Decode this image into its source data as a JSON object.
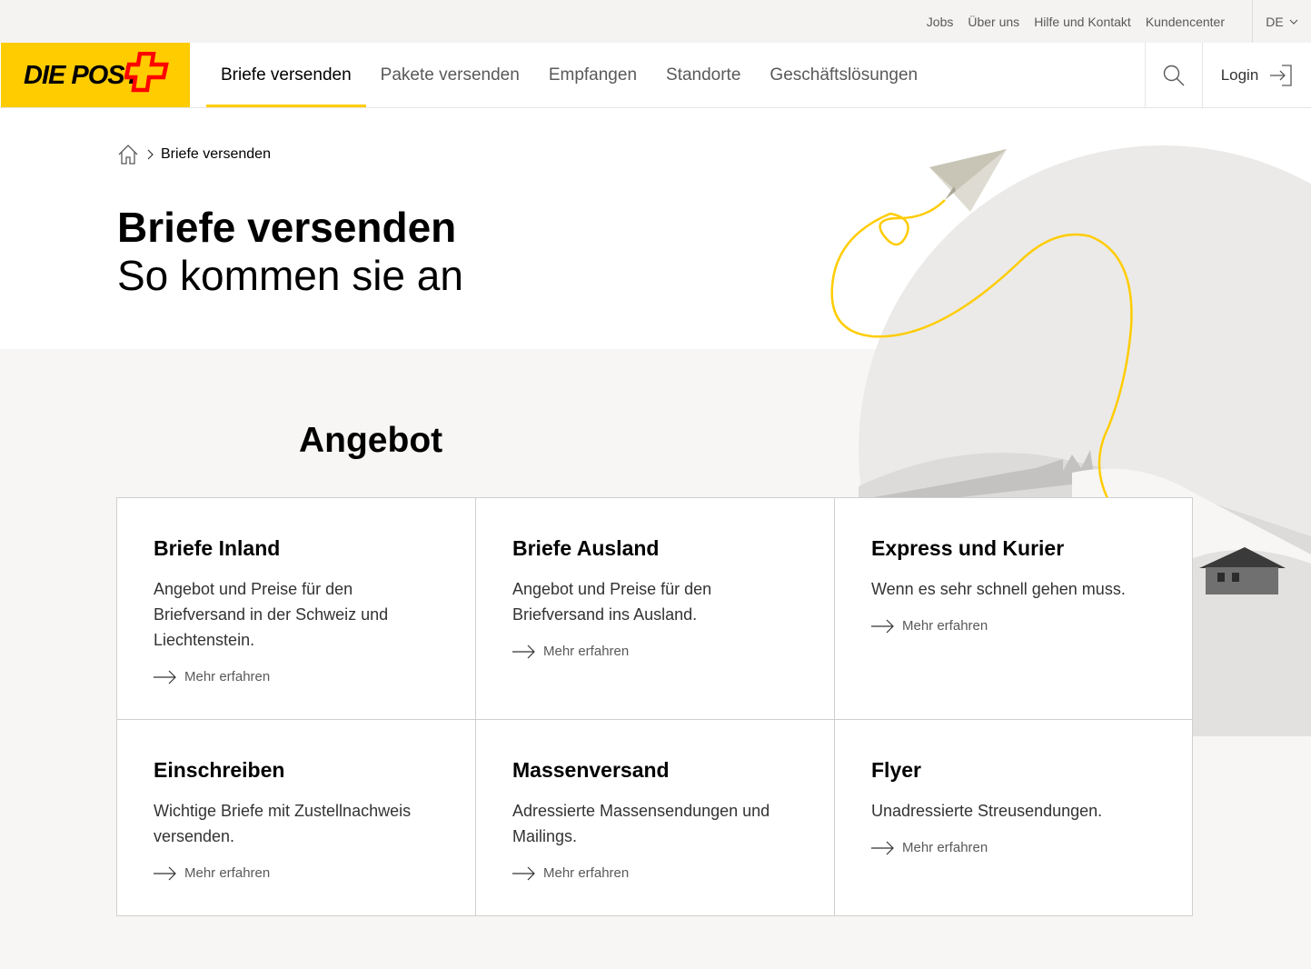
{
  "meta": {
    "links": [
      "Jobs",
      "Über uns",
      "Hilfe und Kontakt",
      "Kundencenter"
    ],
    "language": "DE"
  },
  "logo": {
    "text": "DIE POST",
    "brand_color": "#ffcc00",
    "cross_color": "#ff0000"
  },
  "nav": {
    "items": [
      "Briefe versenden",
      "Pakete versenden",
      "Empfangen",
      "Standorte",
      "Geschäftslösungen"
    ],
    "active": "Briefe versenden",
    "search_icon": "search-icon",
    "login_label": "Login"
  },
  "breadcrumb": {
    "home_icon": "home-icon",
    "current": "Briefe versenden"
  },
  "hero": {
    "title": "Briefe versenden",
    "subtitle": "So kommen sie an"
  },
  "offer": {
    "title": "Angebot",
    "cards": [
      {
        "title": "Briefe Inland",
        "text": "Angebot und Preise für den Briefversand in der Schweiz und Liechtenstein.",
        "link": "Mehr erfahren"
      },
      {
        "title": "Briefe Ausland",
        "text": "Angebot und Preise für den Briefversand ins Ausland.",
        "link": "Mehr erfahren"
      },
      {
        "title": "Express und Kurier",
        "text": "Wenn es sehr schnell gehen muss.",
        "link": "Mehr erfahren"
      },
      {
        "title": "Einschreiben",
        "text": "Wichtige Briefe mit Zustellnachweis versenden.",
        "link": "Mehr erfahren"
      },
      {
        "title": "Massenversand",
        "text": "Adressierte Massensendungen und Mailings.",
        "link": "Mehr erfahren"
      },
      {
        "title": "Flyer",
        "text": "Unadressierte Streusendungen.",
        "link": "Mehr erfahren"
      }
    ]
  }
}
